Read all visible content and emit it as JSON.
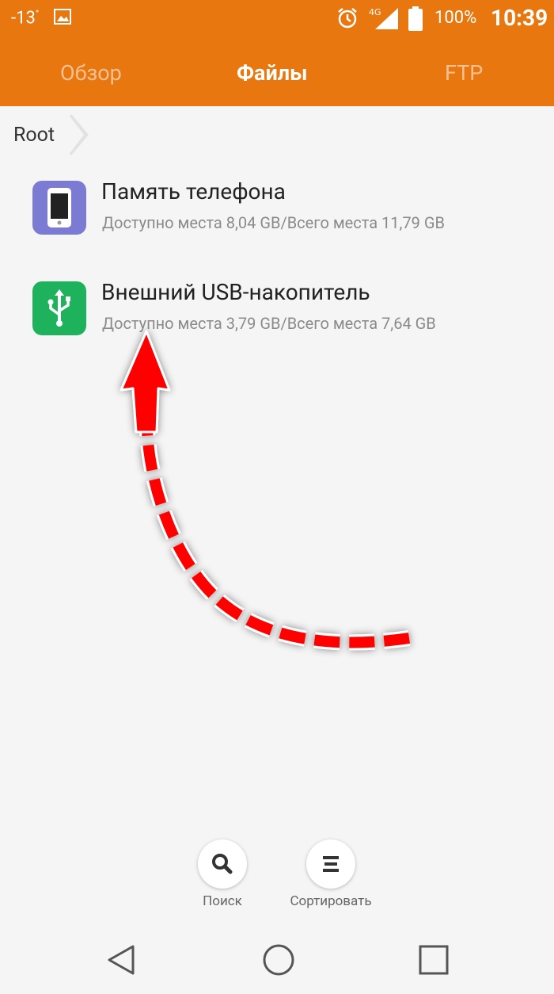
{
  "status_bar": {
    "temperature": "-13",
    "degree": "°",
    "network": "4G",
    "battery": "100%",
    "time": "10:39"
  },
  "tabs": [
    {
      "label": "Обзор",
      "active": false
    },
    {
      "label": "Файлы",
      "active": true
    },
    {
      "label": "FTP",
      "active": false
    }
  ],
  "breadcrumb": {
    "label": "Root"
  },
  "storage": [
    {
      "icon": "phone-icon",
      "title": "Память телефона",
      "subtitle": "Доступно места 8,04 GB/Всего места 11,79 GB",
      "color": "#7b7bd4"
    },
    {
      "icon": "usb-icon",
      "title": "Внешний USB-накопитель",
      "subtitle": "Доступно места 3,79 GB/Всего места 7,64 GB",
      "color": "#1fb25c"
    }
  ],
  "actions": {
    "search_label": "Поиск",
    "sort_label": "Сортировать"
  },
  "colors": {
    "header": "#e8770f",
    "arrow": "#ff0000"
  }
}
